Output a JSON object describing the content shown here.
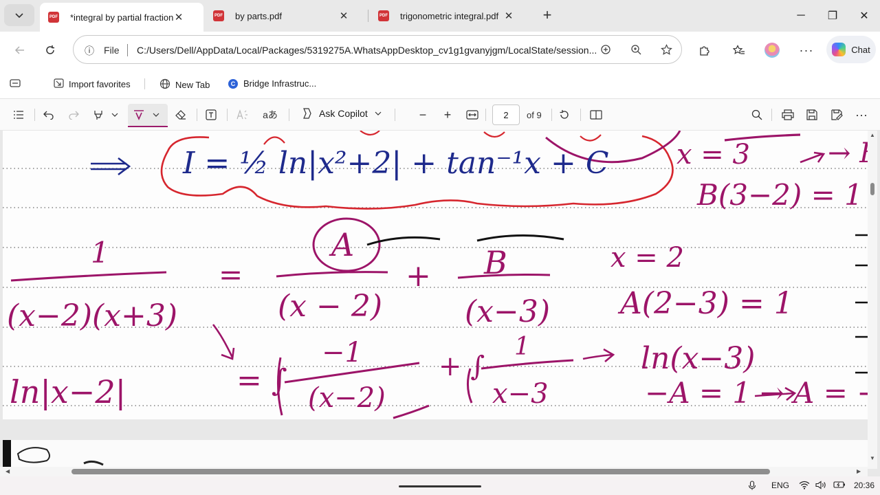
{
  "tabs": [
    {
      "title": "*integral by partial fraction...",
      "active": true
    },
    {
      "title": "by parts.pdf",
      "active": false
    },
    {
      "title": "trigonometric integral.pdf",
      "active": false
    }
  ],
  "tab_close_glyph": "✕",
  "new_tab_glyph": "+",
  "window_controls": {
    "minimize": "─",
    "restore": "❐",
    "close": "✕"
  },
  "address": {
    "info_icon": "ⓘ",
    "scheme_label": "File",
    "url": "C:/Users/Dell/AppData/Local/Packages/5319275A.WhatsAppDesktop_cv1g1gvanyjgm/LocalState/session..."
  },
  "chat_label": "Chat",
  "favorites": [
    {
      "label": "Import favorites",
      "icon": "import-icon"
    },
    {
      "label": "New Tab",
      "icon": "globe-icon"
    },
    {
      "label": "Bridge Infrastruc...",
      "icon": "bridge-site-icon"
    }
  ],
  "pdf_toolbar": {
    "copilot_label": "Ask Copilot",
    "zoom_out": "−",
    "zoom_in": "+",
    "current_page": "2",
    "page_total": "of 9"
  },
  "page_content": {
    "ink_color": "#9c1468",
    "circle_color": "#d6262e",
    "blue_ink": "#1e2a8c",
    "strokes": [
      "⟹",
      "I = ½ ln|x²+2| + tan⁻¹x + C",
      "x = 3",
      "→ B =",
      "B(3−2) = 1",
      "1",
      "=",
      "A",
      "+",
      "B",
      "x = 2",
      "(x−2)(x+3)",
      "(x − 2)",
      "(x−3)",
      "A(2−3) = 1",
      "ln|x−2|",
      "= ∫",
      "−1",
      "(x−2)",
      "+ ∫",
      "1",
      "x−3",
      "→",
      "ln(x−3)",
      "−A = 1 → A = −"
    ]
  },
  "taskbar": {
    "language": "ENG",
    "time": "20:36"
  }
}
